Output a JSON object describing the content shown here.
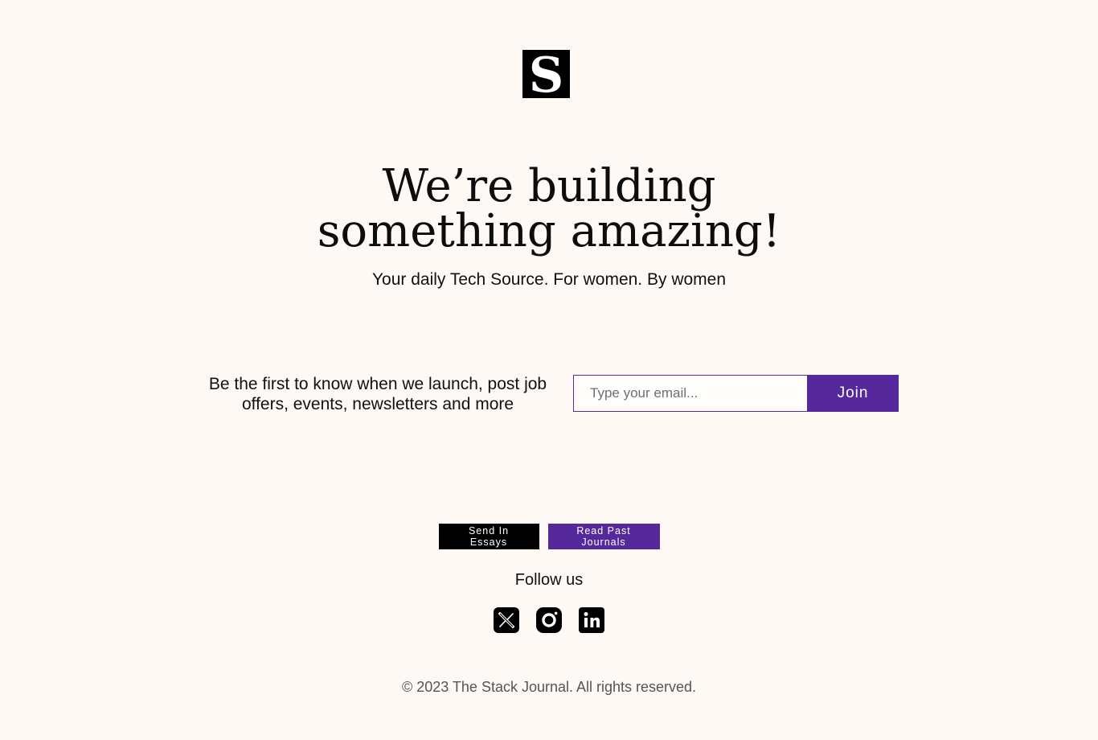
{
  "brand": {
    "logo_letter": "S",
    "name": "The Stack Journal"
  },
  "hero": {
    "headline_line1": "We’re building",
    "headline_line2": "something amazing!",
    "tagline": "Your daily Tech Source. For women. By women"
  },
  "signup": {
    "description": "Be the first to know when we launch, post job offers, events, newsletters and more",
    "email_placeholder": "Type your email...",
    "email_value": "",
    "join_label": "Join"
  },
  "actions": {
    "send_essays_label": "Send In Essays",
    "past_journals_label": "Read Past Journals"
  },
  "social": {
    "follow_label": "Follow us",
    "icons": [
      "x-twitter-icon",
      "instagram-icon",
      "linkedin-icon"
    ]
  },
  "footer": {
    "copyright": "© 2023 The Stack Journal. All rights reserved."
  },
  "colors": {
    "background": "#fff9f5",
    "accent_purple": "#55289b",
    "dark": "#000000"
  }
}
